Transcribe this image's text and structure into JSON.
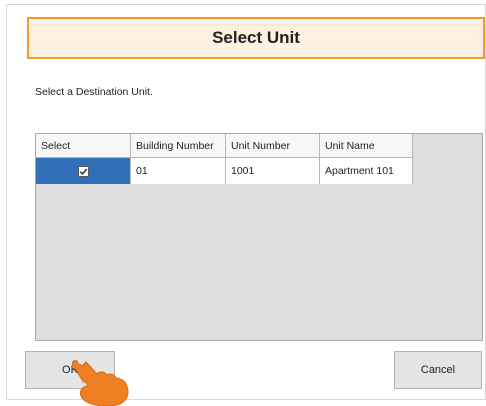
{
  "dialog": {
    "title": "Select Unit",
    "instruction": "Select a Destination Unit."
  },
  "grid": {
    "columns": [
      "Select",
      "Building Number",
      "Unit Number",
      "Unit Name"
    ],
    "rows": [
      {
        "selected": true,
        "building_number": "01",
        "unit_number": "1001",
        "unit_name": "Apartment 101"
      }
    ]
  },
  "buttons": {
    "ok": "OK",
    "cancel": "Cancel"
  },
  "colors": {
    "title_border": "#f29a2e",
    "title_background": "#fdf2e2",
    "selected_cell": "#2e6fb7",
    "pointer_hand": "#ee7f23"
  }
}
